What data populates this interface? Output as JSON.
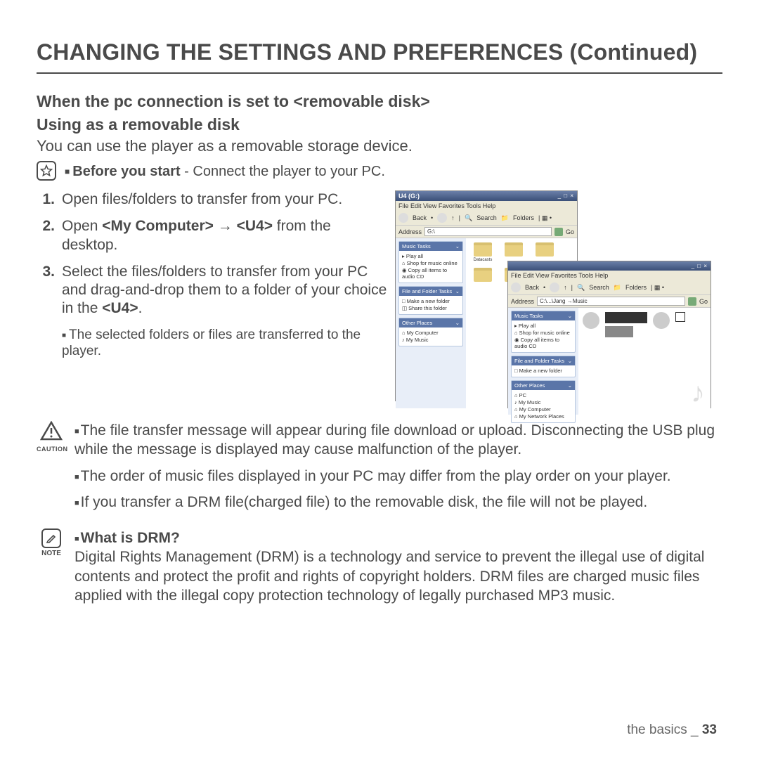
{
  "title": "CHANGING THE SETTINGS AND PREFERENCES (Continued)",
  "subtitle": "When the pc connection is set to <removable disk>",
  "subhead": "Using as a removable disk",
  "intro": "You can use the player as a removable storage device.",
  "before": {
    "label": "Before you start",
    "text": " - Connect the player to your PC."
  },
  "steps": [
    {
      "num": "1.",
      "text": "Open files/folders to transfer from your PC."
    },
    {
      "num": "2.",
      "prefix": "Open ",
      "bold": "<My Computer> → <U4>",
      "suffix": " from the desktop."
    },
    {
      "num": "3.",
      "prefix": "Select the files/folders to transfer from your PC and drag-and-drop them to a folder of your choice in the ",
      "bold": "<U4>",
      "suffix": "."
    }
  ],
  "subbullet": "The selected folders or files are transferred to the player.",
  "explorer1": {
    "title": "U4 (G:)",
    "menu": "File  Edit  View  Favorites  Tools  Help",
    "back": "Back",
    "search": "Search",
    "folders": "Folders",
    "addr_lbl": "Address",
    "addr": "G:\\",
    "panel1": "Music Tasks",
    "p1a": "Play all",
    "p1b": "Shop for music online",
    "p1c": "Copy all items to audio CD",
    "panel2": "File and Folder Tasks",
    "p2a": "Make a new folder",
    "p2b": "Share this folder",
    "panel3": "Other Places",
    "p3a": "My Computer",
    "p3b": "My Music",
    "fold": "Datacasts"
  },
  "explorer2": {
    "title": "",
    "menu": "File  Edit  View  Favorites  Tools  Help",
    "back": "Back",
    "search": "Search",
    "folders": "Folders",
    "addr_lbl": "Address",
    "addr": "C:\\...\\Jang →Music",
    "panel1": "Music Tasks",
    "p1a": "Play all",
    "p1b": "Shop for music online",
    "p1c": "Copy all items to audio CD",
    "panel2": "File and Folder Tasks",
    "p2a": "Make a new folder",
    "panel3": "Other Places",
    "p3a": "PC",
    "p3b": "My Music",
    "p3c": "My Computer",
    "p3d": "My Network Places"
  },
  "caution": {
    "label": "CAUTION",
    "items": [
      "The file transfer message will appear during file download or upload. Disconnecting the USB plug while the message is displayed may cause malfunction of the player.",
      "The order of music files displayed in your PC may differ from the play order on your player.",
      "If you transfer a DRM file(charged file) to the removable disk, the file will not be played."
    ]
  },
  "note": {
    "label": "NOTE",
    "heading": "What is DRM?",
    "text": "Digital Rights Management (DRM) is a technology and service to prevent the illegal use of digital contents and protect the profit and rights of copyright holders. DRM files are charged music files applied with the illegal copy protection technology of legally purchased MP3 music."
  },
  "footer": {
    "section": "the basics _ ",
    "page": "33"
  }
}
